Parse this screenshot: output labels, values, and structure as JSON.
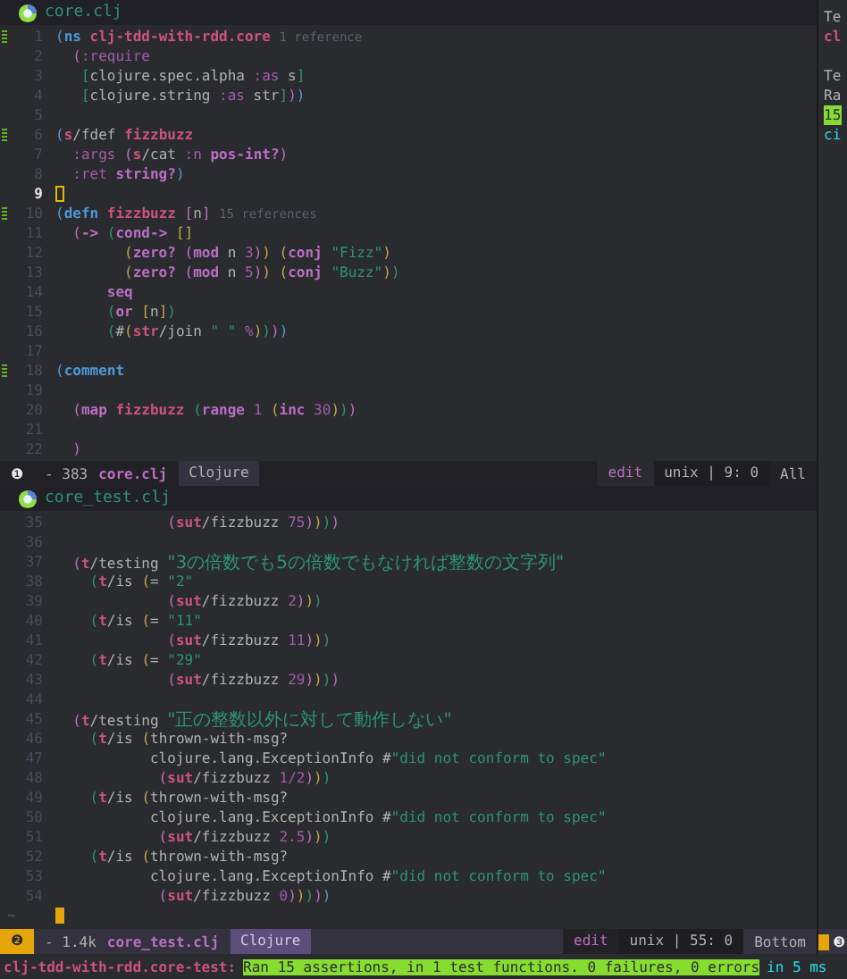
{
  "panes": [
    {
      "title": "core.clj",
      "active": false,
      "lines": [
        {
          "number": "1",
          "marked": true,
          "current": false,
          "tokens": [
            {
              "kind": "paren1",
              "text": "("
            },
            {
              "kind": "special",
              "text": "ns "
            },
            {
              "kind": "name",
              "text": "clj-tdd-with-rdd.core "
            },
            {
              "kind": "hint",
              "text": "1 reference"
            }
          ]
        },
        {
          "number": "2",
          "marked": false,
          "current": false,
          "tokens": [
            {
              "kind": "paren2",
              "text": "  ("
            },
            {
              "kind": "keyword",
              "text": ":require"
            }
          ]
        },
        {
          "number": "3",
          "marked": false,
          "current": false,
          "tokens": [
            {
              "kind": "paren3",
              "text": "   ["
            },
            {
              "kind": "plain",
              "text": "clojure.spec.alpha "
            },
            {
              "kind": "keyword",
              "text": ":as"
            },
            {
              "kind": "plain",
              "text": " s"
            },
            {
              "kind": "paren3",
              "text": "]"
            }
          ]
        },
        {
          "number": "4",
          "marked": false,
          "current": false,
          "tokens": [
            {
              "kind": "paren3",
              "text": "   ["
            },
            {
              "kind": "plain",
              "text": "clojure.string "
            },
            {
              "kind": "keyword",
              "text": ":as"
            },
            {
              "kind": "plain",
              "text": " str"
            },
            {
              "kind": "paren3",
              "text": "]"
            },
            {
              "kind": "paren2",
              "text": ")"
            },
            {
              "kind": "paren1",
              "text": ")"
            }
          ]
        },
        {
          "number": "5",
          "marked": false,
          "current": false
        },
        {
          "number": "6",
          "marked": true,
          "current": false,
          "tokens": [
            {
              "kind": "paren1",
              "text": "("
            },
            {
              "kind": "name",
              "text": "s"
            },
            {
              "kind": "plain",
              "text": "/fdef "
            },
            {
              "kind": "name",
              "text": "fizzbuzz"
            }
          ]
        },
        {
          "number": "7",
          "marked": false,
          "current": false,
          "tokens": [
            {
              "kind": "keyword",
              "text": "  :args "
            },
            {
              "kind": "paren2",
              "text": "("
            },
            {
              "kind": "name",
              "text": "s"
            },
            {
              "kind": "plain",
              "text": "/cat "
            },
            {
              "kind": "keyword",
              "text": ":n "
            },
            {
              "kind": "core",
              "text": "pos-int?"
            },
            {
              "kind": "paren2",
              "text": ")"
            }
          ]
        },
        {
          "number": "8",
          "marked": false,
          "current": false,
          "tokens": [
            {
              "kind": "keyword",
              "text": "  :ret "
            },
            {
              "kind": "core",
              "text": "string?"
            },
            {
              "kind": "paren1",
              "text": ")"
            }
          ]
        },
        {
          "number": "9",
          "marked": false,
          "current": true
        },
        {
          "number": "10",
          "marked": true,
          "current": false,
          "tokens": [
            {
              "kind": "paren1",
              "text": "("
            },
            {
              "kind": "special",
              "text": "defn "
            },
            {
              "kind": "name",
              "text": "fizzbuzz "
            },
            {
              "kind": "paren2",
              "text": "["
            },
            {
              "kind": "plain",
              "text": "n"
            },
            {
              "kind": "paren2",
              "text": "] "
            },
            {
              "kind": "hint",
              "text": "15 references"
            }
          ]
        },
        {
          "number": "11",
          "marked": false,
          "current": false,
          "tokens": [
            {
              "kind": "paren2",
              "text": "  ("
            },
            {
              "kind": "core",
              "text": "-> "
            },
            {
              "kind": "paren3",
              "text": "("
            },
            {
              "kind": "core",
              "text": "cond-> "
            },
            {
              "kind": "paren4",
              "text": "[]"
            }
          ]
        },
        {
          "number": "12",
          "marked": false,
          "current": false,
          "tokens": [
            {
              "kind": "paren4",
              "text": "        ("
            },
            {
              "kind": "core",
              "text": "zero? "
            },
            {
              "kind": "paren5",
              "text": "("
            },
            {
              "kind": "core",
              "text": "mod"
            },
            {
              "kind": "plain",
              "text": " n "
            },
            {
              "kind": "number",
              "text": "3"
            },
            {
              "kind": "paren5",
              "text": ")"
            },
            {
              "kind": "paren4",
              "text": ") ("
            },
            {
              "kind": "core",
              "text": "conj "
            },
            {
              "kind": "string",
              "text": "\"Fizz\""
            },
            {
              "kind": "paren4",
              "text": ")"
            }
          ]
        },
        {
          "number": "13",
          "marked": false,
          "current": false,
          "tokens": [
            {
              "kind": "paren4",
              "text": "        ("
            },
            {
              "kind": "core",
              "text": "zero? "
            },
            {
              "kind": "paren5",
              "text": "("
            },
            {
              "kind": "core",
              "text": "mod"
            },
            {
              "kind": "plain",
              "text": " n "
            },
            {
              "kind": "number",
              "text": "5"
            },
            {
              "kind": "paren5",
              "text": ")"
            },
            {
              "kind": "paren4",
              "text": ") ("
            },
            {
              "kind": "core",
              "text": "conj "
            },
            {
              "kind": "string",
              "text": "\"Buzz\""
            },
            {
              "kind": "paren4",
              "text": ")"
            },
            {
              "kind": "paren3",
              "text": ")"
            }
          ]
        },
        {
          "number": "14",
          "marked": false,
          "current": false,
          "tokens": [
            {
              "kind": "core",
              "text": "      seq"
            }
          ]
        },
        {
          "number": "15",
          "marked": false,
          "current": false,
          "tokens": [
            {
              "kind": "paren3",
              "text": "      ("
            },
            {
              "kind": "core",
              "text": "or "
            },
            {
              "kind": "paren4",
              "text": "["
            },
            {
              "kind": "plain",
              "text": "n"
            },
            {
              "kind": "paren4",
              "text": "]"
            },
            {
              "kind": "paren3",
              "text": ")"
            }
          ]
        },
        {
          "number": "16",
          "marked": false,
          "current": false,
          "tokens": [
            {
              "kind": "paren3",
              "text": "      ("
            },
            {
              "kind": "plain",
              "text": "#"
            },
            {
              "kind": "paren4",
              "text": "("
            },
            {
              "kind": "name",
              "text": "str"
            },
            {
              "kind": "plain",
              "text": "/join "
            },
            {
              "kind": "string",
              "text": "\" \" "
            },
            {
              "kind": "number",
              "text": "%"
            },
            {
              "kind": "paren4",
              "text": ")"
            },
            {
              "kind": "paren3",
              "text": ")"
            },
            {
              "kind": "paren2",
              "text": ")"
            },
            {
              "kind": "paren1",
              "text": ")"
            }
          ]
        },
        {
          "number": "17",
          "marked": false,
          "current": false
        },
        {
          "number": "18",
          "marked": true,
          "current": false,
          "tokens": [
            {
              "kind": "paren1",
              "text": "("
            },
            {
              "kind": "special",
              "text": "comment"
            }
          ]
        },
        {
          "number": "19",
          "marked": false,
          "current": false
        },
        {
          "number": "20",
          "marked": false,
          "current": false,
          "tokens": [
            {
              "kind": "paren2",
              "text": "  ("
            },
            {
              "kind": "core",
              "text": "map "
            },
            {
              "kind": "name",
              "text": "fizzbuzz "
            },
            {
              "kind": "paren3",
              "text": "("
            },
            {
              "kind": "core",
              "text": "range "
            },
            {
              "kind": "number",
              "text": "1 "
            },
            {
              "kind": "paren4",
              "text": "("
            },
            {
              "kind": "core",
              "text": "inc "
            },
            {
              "kind": "number",
              "text": "30"
            },
            {
              "kind": "paren4",
              "text": ")"
            },
            {
              "kind": "paren3",
              "text": ")"
            },
            {
              "kind": "paren2",
              "text": ")"
            }
          ]
        },
        {
          "number": "21",
          "marked": false,
          "current": false
        },
        {
          "number": "22",
          "marked": false,
          "current": false,
          "tokens": [
            {
              "kind": "paren2",
              "text": "  )"
            }
          ]
        }
      ],
      "mode_line": {
        "window_number": "❶",
        "size": "- 383",
        "file": "core.clj",
        "mode": "Clojure",
        "state": "edit",
        "position": "unix | 9: 0",
        "scroll": "All"
      }
    },
    {
      "title": "core_test.clj",
      "active": true,
      "lines": [
        {
          "number": "35",
          "marked": false,
          "current": false,
          "tokens": [
            {
              "kind": "paren5",
              "text": "             ("
            },
            {
              "kind": "name",
              "text": "sut"
            },
            {
              "kind": "plain",
              "text": "/fizzbuzz "
            },
            {
              "kind": "number",
              "text": "75"
            },
            {
              "kind": "paren5",
              "text": ")"
            },
            {
              "kind": "paren4",
              "text": ")"
            },
            {
              "kind": "paren3",
              "text": ")"
            },
            {
              "kind": "paren2",
              "text": ")"
            }
          ]
        },
        {
          "number": "36",
          "marked": false,
          "current": false
        },
        {
          "number": "37",
          "marked": false,
          "current": false,
          "tokens": [
            {
              "kind": "paren2",
              "text": "  ("
            },
            {
              "kind": "name",
              "text": "t"
            },
            {
              "kind": "plain",
              "text": "/testing "
            },
            {
              "kind": "string",
              "text": "\"3の倍数でも5の倍数でもなければ整数の文字列\""
            }
          ]
        },
        {
          "number": "38",
          "marked": false,
          "current": false,
          "tokens": [
            {
              "kind": "paren3",
              "text": "    ("
            },
            {
              "kind": "name",
              "text": "t"
            },
            {
              "kind": "plain",
              "text": "/is "
            },
            {
              "kind": "paren4",
              "text": "("
            },
            {
              "kind": "plain",
              "text": "= "
            },
            {
              "kind": "string",
              "text": "\"2\""
            }
          ]
        },
        {
          "number": "39",
          "marked": false,
          "current": false,
          "tokens": [
            {
              "kind": "paren5",
              "text": "             ("
            },
            {
              "kind": "name",
              "text": "sut"
            },
            {
              "kind": "plain",
              "text": "/fizzbuzz "
            },
            {
              "kind": "number",
              "text": "2"
            },
            {
              "kind": "paren5",
              "text": ")"
            },
            {
              "kind": "paren4",
              "text": ")"
            },
            {
              "kind": "paren3",
              "text": ")"
            }
          ]
        },
        {
          "number": "40",
          "marked": false,
          "current": false,
          "tokens": [
            {
              "kind": "paren3",
              "text": "    ("
            },
            {
              "kind": "name",
              "text": "t"
            },
            {
              "kind": "plain",
              "text": "/is "
            },
            {
              "kind": "paren4",
              "text": "("
            },
            {
              "kind": "plain",
              "text": "= "
            },
            {
              "kind": "string",
              "text": "\"11\""
            }
          ]
        },
        {
          "number": "41",
          "marked": false,
          "current": false,
          "tokens": [
            {
              "kind": "paren5",
              "text": "             ("
            },
            {
              "kind": "name",
              "text": "sut"
            },
            {
              "kind": "plain",
              "text": "/fizzbuzz "
            },
            {
              "kind": "number",
              "text": "11"
            },
            {
              "kind": "paren5",
              "text": ")"
            },
            {
              "kind": "paren4",
              "text": ")"
            },
            {
              "kind": "paren3",
              "text": ")"
            }
          ]
        },
        {
          "number": "42",
          "marked": false,
          "current": false,
          "tokens": [
            {
              "kind": "paren3",
              "text": "    ("
            },
            {
              "kind": "name",
              "text": "t"
            },
            {
              "kind": "plain",
              "text": "/is "
            },
            {
              "kind": "paren4",
              "text": "("
            },
            {
              "kind": "plain",
              "text": "= "
            },
            {
              "kind": "string",
              "text": "\"29\""
            }
          ]
        },
        {
          "number": "43",
          "marked": false,
          "current": false,
          "tokens": [
            {
              "kind": "paren5",
              "text": "             ("
            },
            {
              "kind": "name",
              "text": "sut"
            },
            {
              "kind": "plain",
              "text": "/fizzbuzz "
            },
            {
              "kind": "number",
              "text": "29"
            },
            {
              "kind": "paren5",
              "text": ")"
            },
            {
              "kind": "paren4",
              "text": ")"
            },
            {
              "kind": "paren3",
              "text": ")"
            },
            {
              "kind": "paren2",
              "text": ")"
            }
          ]
        },
        {
          "number": "44",
          "marked": false,
          "current": false
        },
        {
          "number": "45",
          "marked": false,
          "current": false,
          "tokens": [
            {
              "kind": "paren2",
              "text": "  ("
            },
            {
              "kind": "name",
              "text": "t"
            },
            {
              "kind": "plain",
              "text": "/testing "
            },
            {
              "kind": "string",
              "text": "\"正の整数以外に対して動作しない\""
            }
          ]
        },
        {
          "number": "46",
          "marked": false,
          "current": false,
          "tokens": [
            {
              "kind": "paren3",
              "text": "    ("
            },
            {
              "kind": "name",
              "text": "t"
            },
            {
              "kind": "plain",
              "text": "/is "
            },
            {
              "kind": "paren4",
              "text": "("
            },
            {
              "kind": "plain",
              "text": "thrown-with-msg?"
            }
          ]
        },
        {
          "number": "47",
          "marked": false,
          "current": false,
          "tokens": [
            {
              "kind": "plain",
              "text": "           clojure.lang.ExceptionInfo #"
            },
            {
              "kind": "string",
              "text": "\"did not conform to spec\""
            }
          ]
        },
        {
          "number": "48",
          "marked": false,
          "current": false,
          "tokens": [
            {
              "kind": "paren5",
              "text": "            ("
            },
            {
              "kind": "name",
              "text": "sut"
            },
            {
              "kind": "plain",
              "text": "/fizzbuzz "
            },
            {
              "kind": "number",
              "text": "1/2"
            },
            {
              "kind": "paren5",
              "text": ")"
            },
            {
              "kind": "paren4",
              "text": ")"
            },
            {
              "kind": "paren3",
              "text": ")"
            }
          ]
        },
        {
          "number": "49",
          "marked": false,
          "current": false,
          "tokens": [
            {
              "kind": "paren3",
              "text": "    ("
            },
            {
              "kind": "name",
              "text": "t"
            },
            {
              "kind": "plain",
              "text": "/is "
            },
            {
              "kind": "paren4",
              "text": "("
            },
            {
              "kind": "plain",
              "text": "thrown-with-msg?"
            }
          ]
        },
        {
          "number": "50",
          "marked": false,
          "current": false,
          "tokens": [
            {
              "kind": "plain",
              "text": "           clojure.lang.ExceptionInfo #"
            },
            {
              "kind": "string",
              "text": "\"did not conform to spec\""
            }
          ]
        },
        {
          "number": "51",
          "marked": false,
          "current": false,
          "tokens": [
            {
              "kind": "paren5",
              "text": "            ("
            },
            {
              "kind": "name",
              "text": "sut"
            },
            {
              "kind": "plain",
              "text": "/fizzbuzz "
            },
            {
              "kind": "number",
              "text": "2.5"
            },
            {
              "kind": "paren5",
              "text": ")"
            },
            {
              "kind": "paren4",
              "text": ")"
            },
            {
              "kind": "paren3",
              "text": ")"
            }
          ]
        },
        {
          "number": "52",
          "marked": false,
          "current": false,
          "tokens": [
            {
              "kind": "paren3",
              "text": "    ("
            },
            {
              "kind": "name",
              "text": "t"
            },
            {
              "kind": "plain",
              "text": "/is "
            },
            {
              "kind": "paren4",
              "text": "("
            },
            {
              "kind": "plain",
              "text": "thrown-with-msg?"
            }
          ]
        },
        {
          "number": "53",
          "marked": false,
          "current": false,
          "tokens": [
            {
              "kind": "plain",
              "text": "           clojure.lang.ExceptionInfo #"
            },
            {
              "kind": "string",
              "text": "\"did not conform to spec\""
            }
          ]
        },
        {
          "number": "54",
          "marked": false,
          "current": false,
          "tokens": [
            {
              "kind": "paren5",
              "text": "            ("
            },
            {
              "kind": "name",
              "text": "sut"
            },
            {
              "kind": "plain",
              "text": "/fizzbuzz "
            },
            {
              "kind": "number",
              "text": "0"
            },
            {
              "kind": "paren5",
              "text": ")"
            },
            {
              "kind": "paren4",
              "text": ")"
            },
            {
              "kind": "paren3",
              "text": ")"
            },
            {
              "kind": "paren2",
              "text": ")"
            },
            {
              "kind": "paren1",
              "text": ")"
            }
          ]
        },
        {
          "fringe": "~",
          "marked": false,
          "current": true
        }
      ],
      "mode_line": {
        "window_number": "❷",
        "size": "- 1.4k",
        "file": "core_test.clj",
        "mode": "Clojure",
        "state": "edit",
        "position": "unix | 55: 0",
        "scroll": "Bottom"
      }
    }
  ],
  "side_pane": {
    "lines": [
      {
        "text": "Te",
        "kind": "plain"
      },
      {
        "text": "cl",
        "kind": "name"
      },
      {
        "text": "Te",
        "kind": "spaced"
      },
      {
        "text": "Ra",
        "kind": "plain"
      },
      {
        "text": "15",
        "kind": "pass"
      },
      {
        "text": "ci",
        "kind": "teal"
      }
    ],
    "window_number": "❸"
  },
  "echo_area": {
    "namespace": "clj-tdd-with-rdd.core-test:",
    "summary": "Ran 15 assertions, in 1 test functions. 0 failures, 0 errors",
    "timing": "in 5 ms"
  }
}
